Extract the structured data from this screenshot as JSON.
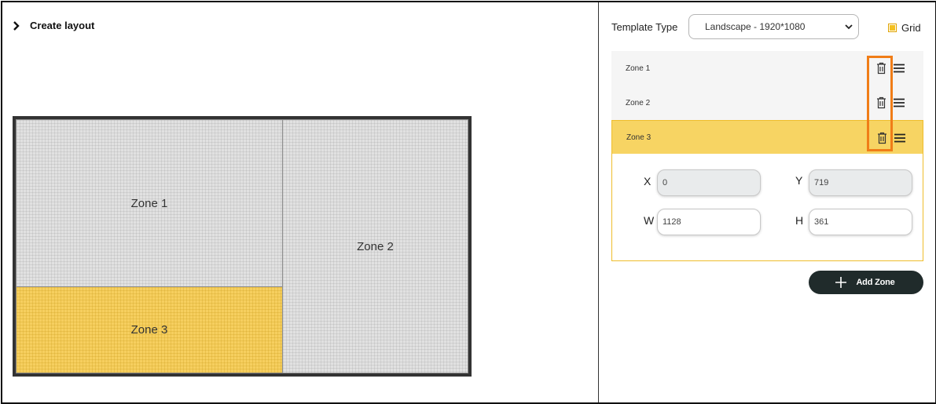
{
  "header": {
    "title": "Create layout"
  },
  "canvas": {
    "zones": [
      {
        "label": "Zone 1",
        "selected": false
      },
      {
        "label": "Zone 2",
        "selected": false
      },
      {
        "label": "Zone 3",
        "selected": true
      }
    ]
  },
  "sidebar": {
    "template_label": "Template Type",
    "template_value": "Landscape - 1920*1080",
    "grid_label": "Grid",
    "grid_checked": true,
    "zone_list": [
      {
        "label": "Zone 1"
      },
      {
        "label": "Zone 2"
      },
      {
        "label": "Zone 3"
      }
    ],
    "selected_zone": {
      "x_label": "X",
      "x_value": "0",
      "y_label": "Y",
      "y_value": "719",
      "w_label": "W",
      "w_value": "1128",
      "h_label": "H",
      "h_value": "361"
    },
    "add_zone_label": "Add Zone"
  },
  "icons": [
    "chevron-right-icon",
    "chevron-down-icon",
    "checkbox-icon",
    "trash-icon",
    "drag-handle-icon",
    "plus-icon"
  ],
  "colors": {
    "accent": "#f6cf5f",
    "accent_border": "#efbd2b",
    "highlight": "#f07d17",
    "button": "#202b2b"
  }
}
